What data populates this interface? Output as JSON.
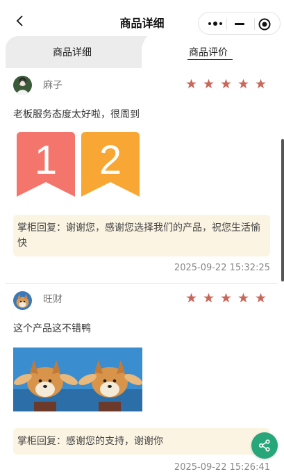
{
  "nav": {
    "title": "商品详细"
  },
  "tabs": [
    {
      "label": "商品详细",
      "active": false
    },
    {
      "label": "商品评价",
      "active": true
    }
  ],
  "reviews": [
    {
      "username": "麻子",
      "rating": 5,
      "comment": "老板服务态度太好啦，很周到",
      "images": [
        {
          "text": "1",
          "color": "#f4756b"
        },
        {
          "text": "2",
          "color": "#f9a734"
        }
      ],
      "reply": "掌柜回复：谢谢您，感谢您选择我们的产品，祝您生活愉快",
      "time": "2025-09-22 15:32:25"
    },
    {
      "username": "旺财",
      "rating": 5,
      "comment": "这个产品这不错鸭",
      "reply": "掌柜回复：感谢您的支持，谢谢你",
      "time": "2025-09-22 15:26:41"
    }
  ],
  "colors": {
    "star": "#c9675a",
    "share": "#27a67a",
    "reply_bg": "#fbf4e3"
  },
  "icons": {
    "back": "chevron-left-icon",
    "more": "more-dots-icon",
    "minimize": "minus-icon",
    "close": "target-circle-icon",
    "share": "share-icon"
  }
}
